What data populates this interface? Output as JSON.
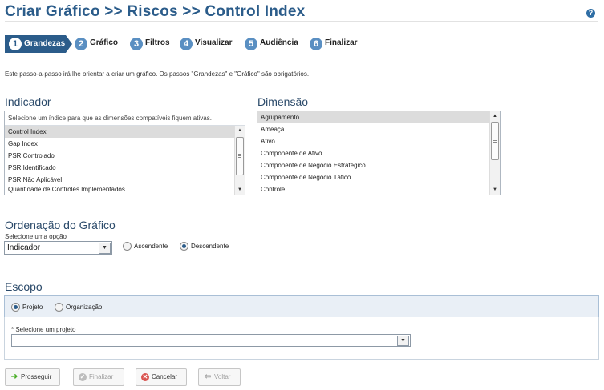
{
  "page": {
    "title": "Criar Gráfico >> Riscos >> Control Index",
    "help_label": "?"
  },
  "steps": [
    {
      "num": "1",
      "label": "Grandezas",
      "active": true
    },
    {
      "num": "2",
      "label": "Gráfico"
    },
    {
      "num": "3",
      "label": "Filtros"
    },
    {
      "num": "4",
      "label": "Visualizar"
    },
    {
      "num": "5",
      "label": "Audiência"
    },
    {
      "num": "6",
      "label": "Finalizar"
    }
  ],
  "intro": "Este passo-a-passo irá lhe orientar a criar um gráfico. Os passos \"Grandezas\" e \"Gráfico\" são obrigatórios.",
  "indicador": {
    "heading": "Indicador",
    "hint": "Selecione um índice para que as dimensões compatíveis fiquem ativas.",
    "items": [
      "Control Index",
      "Gap Index",
      "PSR Controlado",
      "PSR Identificado",
      "PSR Não Aplicável",
      "Quantidade de Controles Implementados"
    ],
    "selected": "Control Index"
  },
  "dimensao": {
    "heading": "Dimensão",
    "items": [
      "Agrupamento",
      "Ameaça",
      "Ativo",
      "Componente de Ativo",
      "Componente de Negócio Estratégico",
      "Componente de Negócio Tático",
      "Controle"
    ],
    "selected": "Agrupamento"
  },
  "ordenacao": {
    "heading": "Ordenação do Gráfico",
    "select_label": "Selecione uma opção",
    "select_value": "Indicador",
    "asc_label": "Ascendente",
    "desc_label": "Descendente",
    "selected": "Descendente"
  },
  "escopo": {
    "heading": "Escopo",
    "projeto_label": "Projeto",
    "organizacao_label": "Organização",
    "selected": "Projeto",
    "project_label": "* Selecione um projeto",
    "project_value": ""
  },
  "buttons": {
    "prosseguir": "Prosseguir",
    "finalizar": "Finalizar",
    "cancelar": "Cancelar",
    "voltar": "Voltar"
  },
  "colors": {
    "title": "#2b5c8a",
    "step_active": "#2b5c8a",
    "step_circle": "#5a8fc2",
    "prosseguir_icon": "#4caf2a",
    "cancelar_icon": "#d9534f"
  },
  "icons": {
    "help": "help-icon",
    "prosseguir": "arrow-right-icon",
    "finalizar": "check-icon",
    "cancelar": "cancel-icon",
    "voltar": "arrow-left-icon"
  }
}
